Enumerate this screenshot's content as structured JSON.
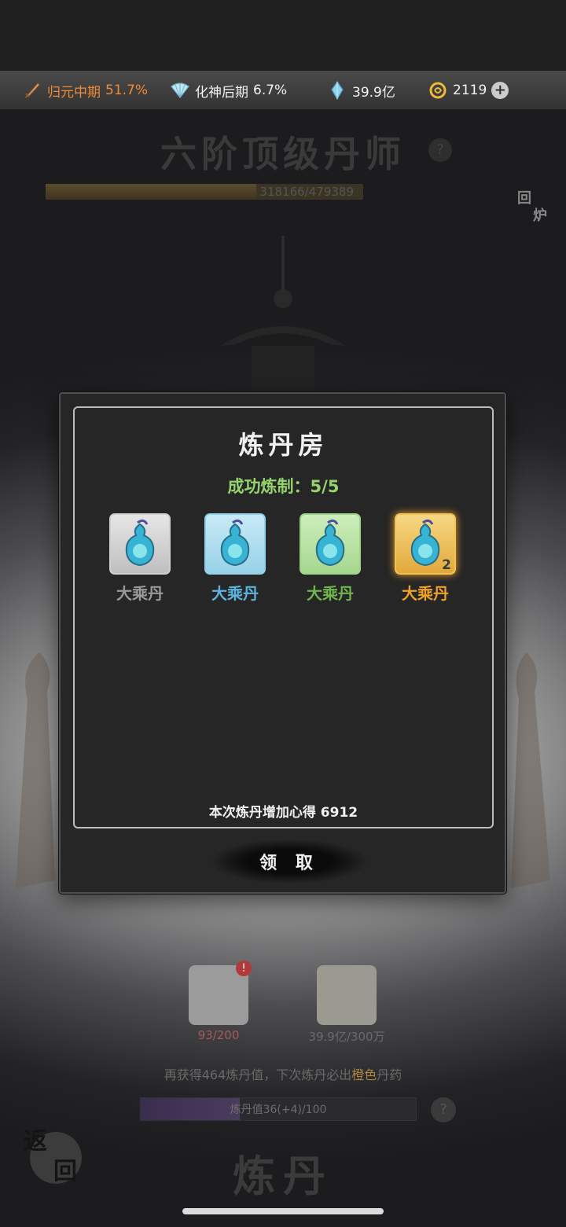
{
  "status_bar": {
    "cultivation_label": "归元中期",
    "cultivation_percent": "51.7%",
    "spirit_label": "化神后期",
    "spirit_percent": "6.7%",
    "crystals": "39.9亿",
    "coins": "2119"
  },
  "background": {
    "rank_title": "六阶顶级丹师",
    "exp_progress": "318166/479389",
    "exp_fraction": 0.664,
    "return_furnace_label": [
      "回",
      "炉"
    ],
    "material1_count": "93/200",
    "material2_count": "39.9亿/300万",
    "hint_before": "再获得464炼丹值，下次炼丹必出",
    "hint_highlight": "橙色",
    "hint_after": "丹药",
    "refine_bar_text": "炼丹值36(+4)/100",
    "refine_bar_fraction": 0.36,
    "back_label": [
      "返",
      "回"
    ],
    "refine_button_label": "炼丹"
  },
  "dialog": {
    "title": "炼丹房",
    "subtitle": "成功炼制：5/5",
    "items": [
      {
        "name": "大乘丹",
        "quality": "white",
        "name_color": "#9a9a9a",
        "count": ""
      },
      {
        "name": "大乘丹",
        "quality": "blue",
        "name_color": "#5db3e0",
        "count": ""
      },
      {
        "name": "大乘丹",
        "quality": "green",
        "name_color": "#6fb44d",
        "count": ""
      },
      {
        "name": "大乘丹",
        "quality": "orange",
        "name_color": "#f0a12a",
        "count": "2"
      }
    ],
    "footer": "本次炼丹增加心得 6912",
    "claim_label": "领 取"
  }
}
